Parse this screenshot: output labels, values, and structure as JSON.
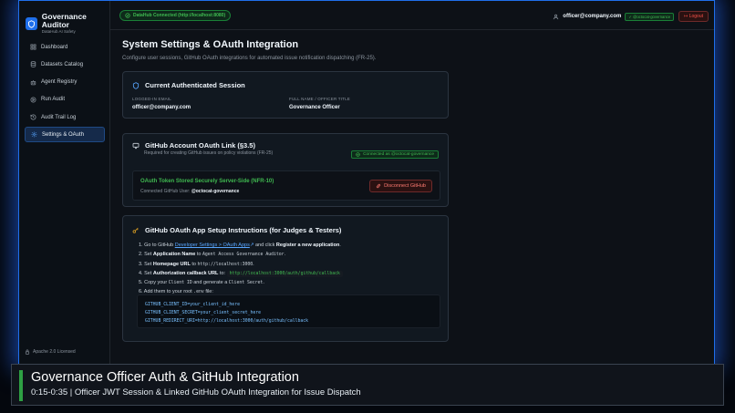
{
  "app": {
    "title": "Governance Auditor",
    "subtitle": "DataHub AI Safety"
  },
  "sidebar": {
    "items": [
      {
        "label": "Dashboard",
        "icon": "grid-icon"
      },
      {
        "label": "Datasets Catalog",
        "icon": "database-icon"
      },
      {
        "label": "Agent Registry",
        "icon": "bot-icon"
      },
      {
        "label": "Run Audit",
        "icon": "play-icon"
      },
      {
        "label": "Audit Trail Log",
        "icon": "history-icon"
      },
      {
        "label": "Settings & OAuth",
        "icon": "gear-icon",
        "active": true
      }
    ],
    "license": "Apache 2.0 Licensed"
  },
  "topbar": {
    "connection": "DataHub Connected (http://localhost:8080)",
    "user_email": "officer@company.com",
    "github_badge": "@octocat-governance",
    "logout": "Logout"
  },
  "page": {
    "title": "System Settings & OAuth Integration",
    "subtitle": "Configure user sessions, GitHub OAuth integrations for automated issue notification dispatching (FR-25)."
  },
  "session": {
    "title": "Current Authenticated Session",
    "email_label": "LOGGED-IN EMAIL",
    "email_value": "officer@company.com",
    "name_label": "FULL NAME / OFFICER TITLE",
    "name_value": "Governance Officer"
  },
  "github_link": {
    "title": "GitHub Account OAuth Link (§3.5)",
    "subtitle": "Required for creating GitHub issues on policy violations (FR-25)",
    "status": "Connected as @octocat-governance",
    "token_title": "OAuth Token Stored Securely Server-Side (NFR-10)",
    "user_label": "Connected GitHub User:",
    "user_value": "@octocat-governance",
    "disconnect": "Disconnect GitHub"
  },
  "setup": {
    "title": "GitHub OAuth App Setup Instructions (for Judges & Testers)",
    "s1_a": "1. Go to GitHub ",
    "s1_link": "Developer Settings > OAuth Apps",
    "s1_b": " and click ",
    "s1_c": "Register a new application",
    "s1_d": ".",
    "s2_a": "2. Set ",
    "s2_b": "Application Name",
    "s2_c": " to ",
    "s2_d": "Agent Access Governance Auditor",
    "s2_e": ".",
    "s3_a": "3. Set ",
    "s3_b": "Homepage URL",
    "s3_c": " to ",
    "s3_d": "http://localhost:3000",
    "s3_e": ".",
    "s4_a": "4. Set ",
    "s4_b": "Authorization callback URL",
    "s4_c": " to: ",
    "s4_d": "http://localhost:3000/auth/github/callback",
    "s5_a": "5. Copy your ",
    "s5_b": "Client ID",
    "s5_c": " and generate a ",
    "s5_d": "Client Secret",
    "s5_e": ".",
    "s6_a": "6. Add them to your root ",
    "s6_b": ".env",
    "s6_c": " file:",
    "env_lines": [
      "GITHUB_CLIENT_ID=your_client_id_here",
      "GITHUB_CLIENT_SECRET=your_client_secret_here",
      "GITHUB_REDIRECT_URI=http://localhost:3000/auth/github/callback"
    ]
  },
  "banner": {
    "title": "Governance Officer Auth & GitHub Integration",
    "subtitle": "0:15-0:35 | Officer JWT Session & Linked GitHub OAuth Integration for Issue Dispatch"
  },
  "colors": {
    "accent": "#1f6feb",
    "success": "#3fb950",
    "danger": "#f85149",
    "link": "#58a6ff"
  }
}
